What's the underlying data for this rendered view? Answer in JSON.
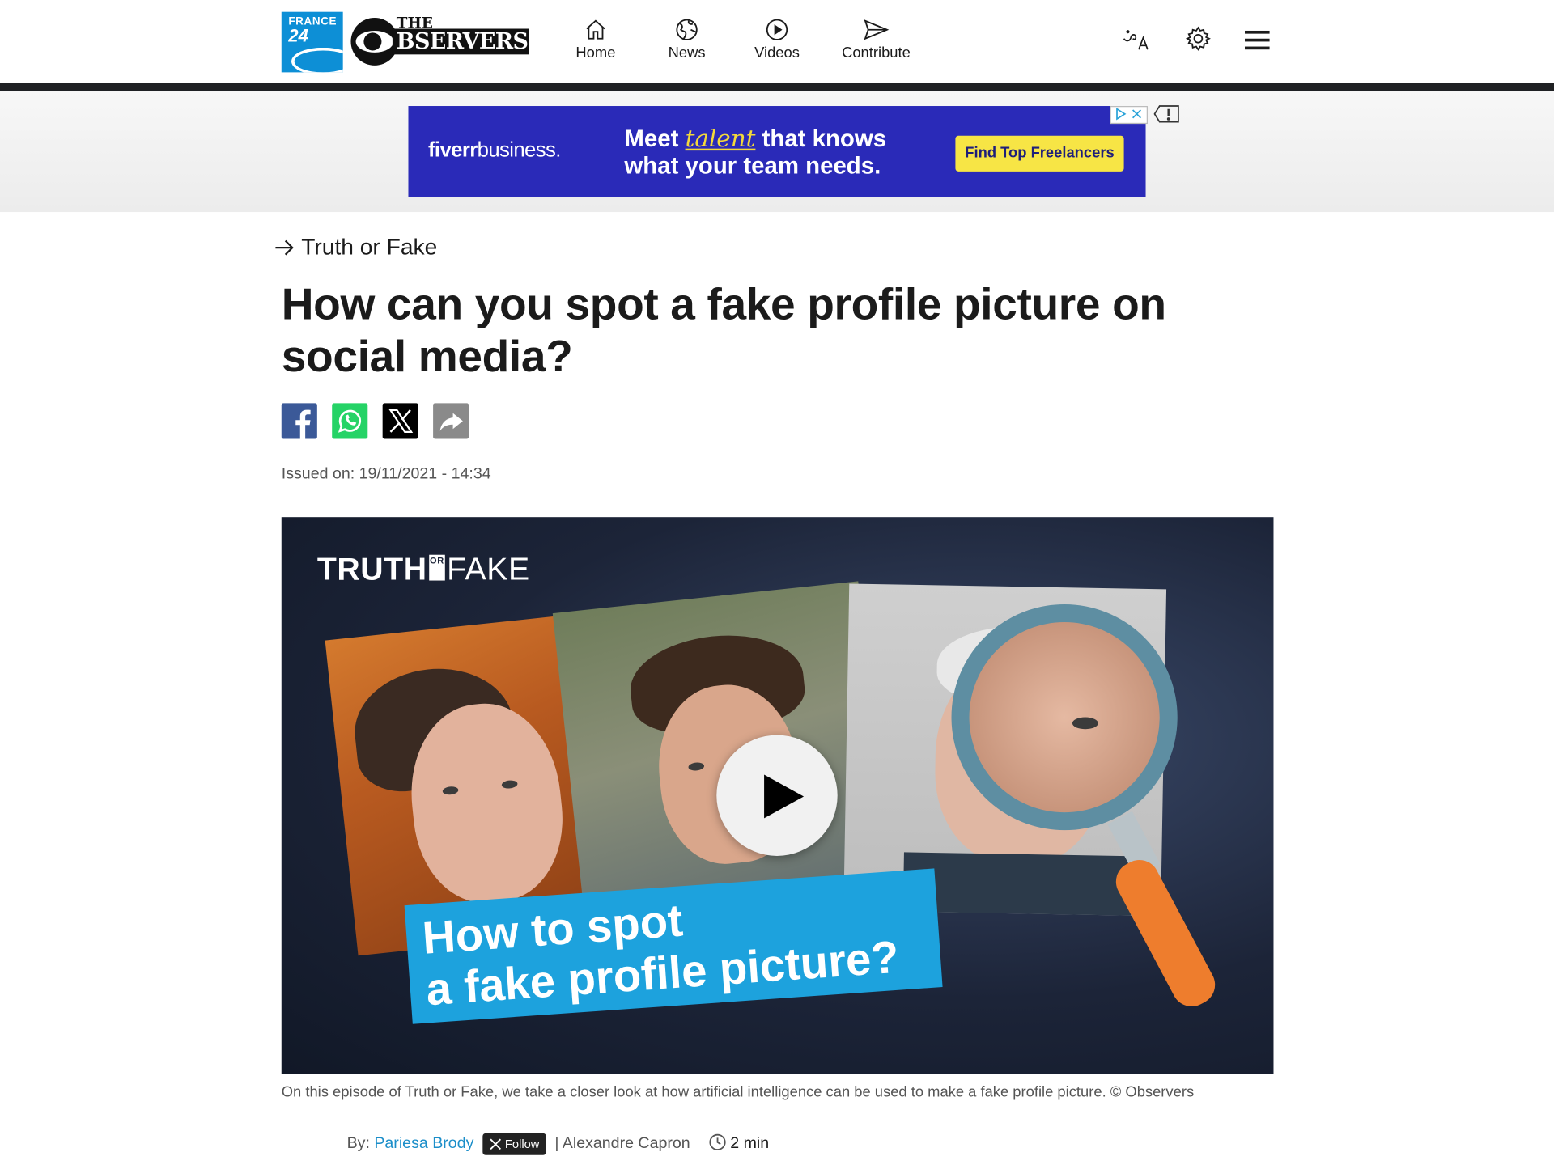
{
  "header": {
    "france24_logo": {
      "line1": "FRANCE",
      "line2": "24"
    },
    "observers_logo": {
      "the": "THE",
      "word": "BSERVERS"
    },
    "nav": [
      {
        "label": "Home",
        "icon": "home-icon"
      },
      {
        "label": "News",
        "icon": "globe-icon"
      },
      {
        "label": "Videos",
        "icon": "play-circle-icon"
      },
      {
        "label": "Contribute",
        "icon": "send-icon"
      }
    ],
    "language_icon": "language-icon",
    "settings_icon": "gear-icon",
    "menu_icon": "hamburger-menu-icon"
  },
  "ad": {
    "brand": "fiverr",
    "brand_suffix": "business.",
    "headline_start": "Meet",
    "headline_italic": "talent",
    "headline_end": "that knows",
    "headline_line2": "what your team needs.",
    "cta": "Find Top Freelancers"
  },
  "article": {
    "category": "Truth or Fake",
    "title": "How can you spot a fake profile picture on social media?",
    "share": [
      "facebook-icon",
      "whatsapp-icon",
      "x-icon",
      "share-icon"
    ],
    "issued": "Issued on: 19/11/2021 - 14:34",
    "video": {
      "brand_bold": "TRUTH",
      "brand_or": "OR",
      "brand_light": "FAKE",
      "title_line1": "How to spot",
      "title_line2": "a fake profile picture?"
    },
    "caption": "On this episode of Truth or Fake, we take a closer look at how artificial intelligence can be used to make a fake profile picture.  © Observers",
    "byline": {
      "by": "By:",
      "author1": "Pariesa Brody",
      "follow": "Follow",
      "separator": "|",
      "author2": "Alexandre Capron",
      "read_time": "2 min"
    }
  },
  "colors": {
    "france24_blue": "#0d8fd6",
    "ad_background": "#2a2ab8",
    "ad_cta": "#f7e545",
    "facebook": "#3b5998",
    "whatsapp": "#25d366",
    "video_title_band": "#1da2dd",
    "link_blue": "#1b8ec9"
  }
}
